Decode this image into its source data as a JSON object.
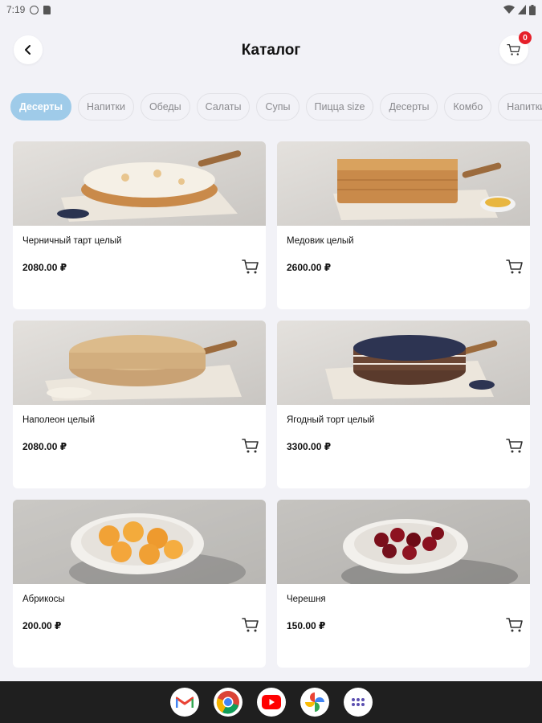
{
  "status": {
    "time": "7:19"
  },
  "header": {
    "title": "Каталог",
    "cart_count": "0"
  },
  "categories": [
    {
      "label": "Десерты",
      "active": true
    },
    {
      "label": "Напитки"
    },
    {
      "label": "Обеды"
    },
    {
      "label": "Салаты"
    },
    {
      "label": "Супы"
    },
    {
      "label": "Пицца size"
    },
    {
      "label": "Десерты"
    },
    {
      "label": "Комбо"
    },
    {
      "label": "Напитки"
    }
  ],
  "products": [
    {
      "name": "Черничный тарт целый",
      "price": "2080.00 ₽",
      "image": "blueberry-tart-photo"
    },
    {
      "name": "Медовик целый",
      "price": "2600.00 ₽",
      "image": "honey-cake-photo"
    },
    {
      "name": "Наполеон целый",
      "price": "2080.00 ₽",
      "image": "napoleon-cake-photo"
    },
    {
      "name": "Ягодный торт целый",
      "price": "3300.00 ₽",
      "image": "berry-cake-photo"
    },
    {
      "name": "Абрикосы",
      "price": "200.00 ₽",
      "image": "apricots-photo"
    },
    {
      "name": "Черешня",
      "price": "150.00 ₽",
      "image": "cherries-photo"
    }
  ],
  "dock": [
    {
      "name": "gmail-icon"
    },
    {
      "name": "chrome-icon"
    },
    {
      "name": "youtube-icon"
    },
    {
      "name": "photos-icon"
    },
    {
      "name": "app-drawer-icon"
    }
  ],
  "colors": {
    "accent": "#9fcbe9",
    "badge": "#e6202a",
    "background": "#f2f2f7"
  }
}
